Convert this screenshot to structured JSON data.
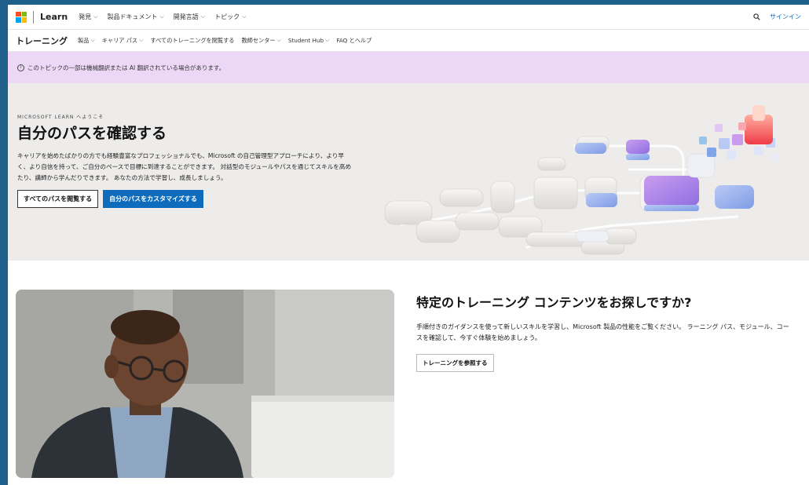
{
  "header": {
    "brand": "Learn",
    "nav": [
      "発見",
      "製品ドキュメント",
      "開発言語",
      "トピック"
    ],
    "sign_in": "サインイン"
  },
  "subnav": {
    "title": "トレーニング",
    "items": [
      {
        "label": "製品",
        "dropdown": true
      },
      {
        "label": "キャリア パス",
        "dropdown": true
      },
      {
        "label": "すべてのトレーニングを閲覧する",
        "dropdown": false
      },
      {
        "label": "教師センター",
        "dropdown": true
      },
      {
        "label": "Student Hub",
        "dropdown": true
      },
      {
        "label": "FAQ とヘルプ",
        "dropdown": false
      }
    ]
  },
  "notice": {
    "icon": "info-icon",
    "text": "このトピックの一部は機械翻訳または AI 翻訳されている場合があります。"
  },
  "hero": {
    "eyebrow": "MICROSOFT LEARN へようこそ",
    "title": "自分のパスを確認する",
    "body": "キャリアを始めたばかりの方でも経験豊富なプロフェッショナルでも、Microsoft の自己管理型アプローチにより、より早く、より自信を持って、ご自分のペースで目標に到達することができます。 対話型のモジュールやパスを通じてスキルを高めたり、講師から学んだりできます。 あなたの方法で学習し、成長しましょう。",
    "btn_browse": "すべてのパスを閲覧する",
    "btn_customize": "自分のパスをカスタマイズする"
  },
  "promo": {
    "title": "特定のトレーニング コンテンツをお探しですか?",
    "body": "手順付きのガイダンスを使って新しいスキルを学習し、Microsoft 製品の性能をご覧ください。 ラーニング パス、モジュール、コースを確認して、今すぐ体験を始めましょう。",
    "button": "トレーニングを参照する"
  },
  "colors": {
    "accent": "#0f6cbd",
    "notice_bg": "#ecd8f6",
    "hero_bg": "#edeceb",
    "ms_red": "#f25022",
    "ms_green": "#7fba00",
    "ms_blue": "#00a4ef",
    "ms_yellow": "#ffb900"
  }
}
